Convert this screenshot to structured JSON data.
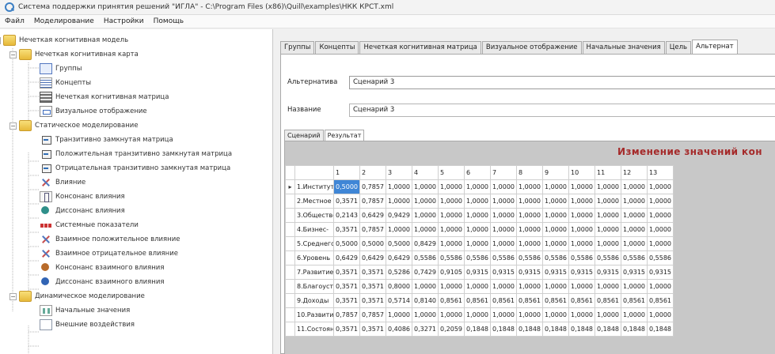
{
  "window": {
    "title": "Система поддержки принятия решений \"ИГЛА\" - C:\\Program Files (x86)\\Quill\\examples\\НКК КРСТ.xml"
  },
  "menu": [
    "Файл",
    "Моделирование",
    "Настройки",
    "Помощь"
  ],
  "tree": {
    "items": [
      {
        "label": "Нечеткая когнитивная модель",
        "icon": "folder-icon"
      },
      {
        "label": "Нечеткая когнитивная карта",
        "icon": "folder-icon"
      },
      {
        "label": "Группы",
        "icon": "groups-icon"
      },
      {
        "label": "Концепты",
        "icon": "concepts-icon"
      },
      {
        "label": "Нечеткая когнитивная матрица",
        "icon": "matrix-icon"
      },
      {
        "label": "Визуальное отображение",
        "icon": "graph-icon"
      },
      {
        "label": "Статическое моделирование",
        "icon": "folder-icon"
      },
      {
        "label": "Транзитивно замкнутая матрица",
        "icon": "transitive-matrix-icon"
      },
      {
        "label": "Положительная транзитивно замкнутая матрица",
        "icon": "positive-matrix-icon"
      },
      {
        "label": "Отрицательная транзитивно замкнутая матрица",
        "icon": "negative-matrix-icon"
      },
      {
        "label": "Влияние",
        "icon": "influence-icon"
      },
      {
        "label": "Консонанс влияния",
        "icon": "consonance-icon"
      },
      {
        "label": "Диссонанс влияния",
        "icon": "dissonance-icon"
      },
      {
        "label": "Системные показатели",
        "icon": "system-indicators-icon"
      },
      {
        "label": "Взаимное положительное влияние",
        "icon": "mutual-positive-icon"
      },
      {
        "label": "Взаимное отрицательное влияние",
        "icon": "mutual-negative-icon"
      },
      {
        "label": "Консонанс взаимного влияния",
        "icon": "mutual-consonance-icon"
      },
      {
        "label": "Диссонанс взаимного влияния",
        "icon": "mutual-dissonance-icon"
      },
      {
        "label": "Динамическое моделирование",
        "icon": "folder-icon"
      },
      {
        "label": "Начальные значения",
        "icon": "initial-values-icon"
      },
      {
        "label": "Внешние воздействия",
        "icon": "external-effects-icon"
      }
    ]
  },
  "tabs": [
    "Группы",
    "Концепты",
    "Нечеткая когнитивная матрица",
    "Визуальное отображение",
    "Начальные значения",
    "Цель",
    "Альтернат"
  ],
  "form": {
    "alternative_label": "Альтернатива",
    "alternative_value": "Сценарий 3",
    "name_label": "Название",
    "name_value": "Сценарий 3"
  },
  "subtabs": [
    "Сценарий",
    "Результат"
  ],
  "grid": {
    "heading": "Изменение значений кон",
    "columns": [
      "1",
      "2",
      "3",
      "4",
      "5",
      "6",
      "7",
      "8",
      "9",
      "10",
      "11",
      "12",
      "13"
    ],
    "rows": [
      {
        "name": "1.Институты",
        "values": [
          "0,5000",
          "0,7857",
          "1,0000",
          "1,0000",
          "1,0000",
          "1,0000",
          "1,0000",
          "1,0000",
          "1,0000",
          "1,0000",
          "1,0000",
          "1,0000",
          "1,0000"
        ]
      },
      {
        "name": "2.Местное",
        "values": [
          "0,3571",
          "0,7857",
          "1,0000",
          "1,0000",
          "1,0000",
          "1,0000",
          "1,0000",
          "1,0000",
          "1,0000",
          "1,0000",
          "1,0000",
          "1,0000",
          "1,0000"
        ]
      },
      {
        "name": "3.Обществен",
        "values": [
          "0,2143",
          "0,6429",
          "0,9429",
          "1,0000",
          "1,0000",
          "1,0000",
          "1,0000",
          "1,0000",
          "1,0000",
          "1,0000",
          "1,0000",
          "1,0000",
          "1,0000"
        ]
      },
      {
        "name": "4.Бизнес-",
        "values": [
          "0,3571",
          "0,7857",
          "1,0000",
          "1,0000",
          "1,0000",
          "1,0000",
          "1,0000",
          "1,0000",
          "1,0000",
          "1,0000",
          "1,0000",
          "1,0000",
          "1,0000"
        ]
      },
      {
        "name": "5.Среднегоо",
        "values": [
          "0,5000",
          "0,5000",
          "0,5000",
          "0,8429",
          "1,0000",
          "1,0000",
          "1,0000",
          "1,0000",
          "1,0000",
          "1,0000",
          "1,0000",
          "1,0000",
          "1,0000"
        ]
      },
      {
        "name": "6.Уровень",
        "values": [
          "0,6429",
          "0,6429",
          "0,6429",
          "0,5586",
          "0,5586",
          "0,5586",
          "0,5586",
          "0,5586",
          "0,5586",
          "0,5586",
          "0,5586",
          "0,5586",
          "0,5586"
        ]
      },
      {
        "name": "7.Развитие",
        "values": [
          "0,3571",
          "0,3571",
          "0,5286",
          "0,7429",
          "0,9105",
          "0,9315",
          "0,9315",
          "0,9315",
          "0,9315",
          "0,9315",
          "0,9315",
          "0,9315",
          "0,9315"
        ]
      },
      {
        "name": "8.Благоустро",
        "values": [
          "0,3571",
          "0,3571",
          "0,8000",
          "1,0000",
          "1,0000",
          "1,0000",
          "1,0000",
          "1,0000",
          "1,0000",
          "1,0000",
          "1,0000",
          "1,0000",
          "1,0000"
        ]
      },
      {
        "name": "9.Доходы",
        "values": [
          "0,3571",
          "0,3571",
          "0,5714",
          "0,8140",
          "0,8561",
          "0,8561",
          "0,8561",
          "0,8561",
          "0,8561",
          "0,8561",
          "0,8561",
          "0,8561",
          "0,8561"
        ]
      },
      {
        "name": "10.Развитие",
        "values": [
          "0,7857",
          "0,7857",
          "1,0000",
          "1,0000",
          "1,0000",
          "1,0000",
          "1,0000",
          "1,0000",
          "1,0000",
          "1,0000",
          "1,0000",
          "1,0000",
          "1,0000"
        ]
      },
      {
        "name": "11.Состояние",
        "values": [
          "0,3571",
          "0,3571",
          "0,4086",
          "0,3271",
          "0,2059",
          "0,1848",
          "0,1848",
          "0,1848",
          "0,1848",
          "0,1848",
          "0,1848",
          "0,1848",
          "0,1848"
        ]
      }
    ]
  },
  "colors": {
    "selection": "#3f86d6",
    "heading": "#a52a2a"
  }
}
